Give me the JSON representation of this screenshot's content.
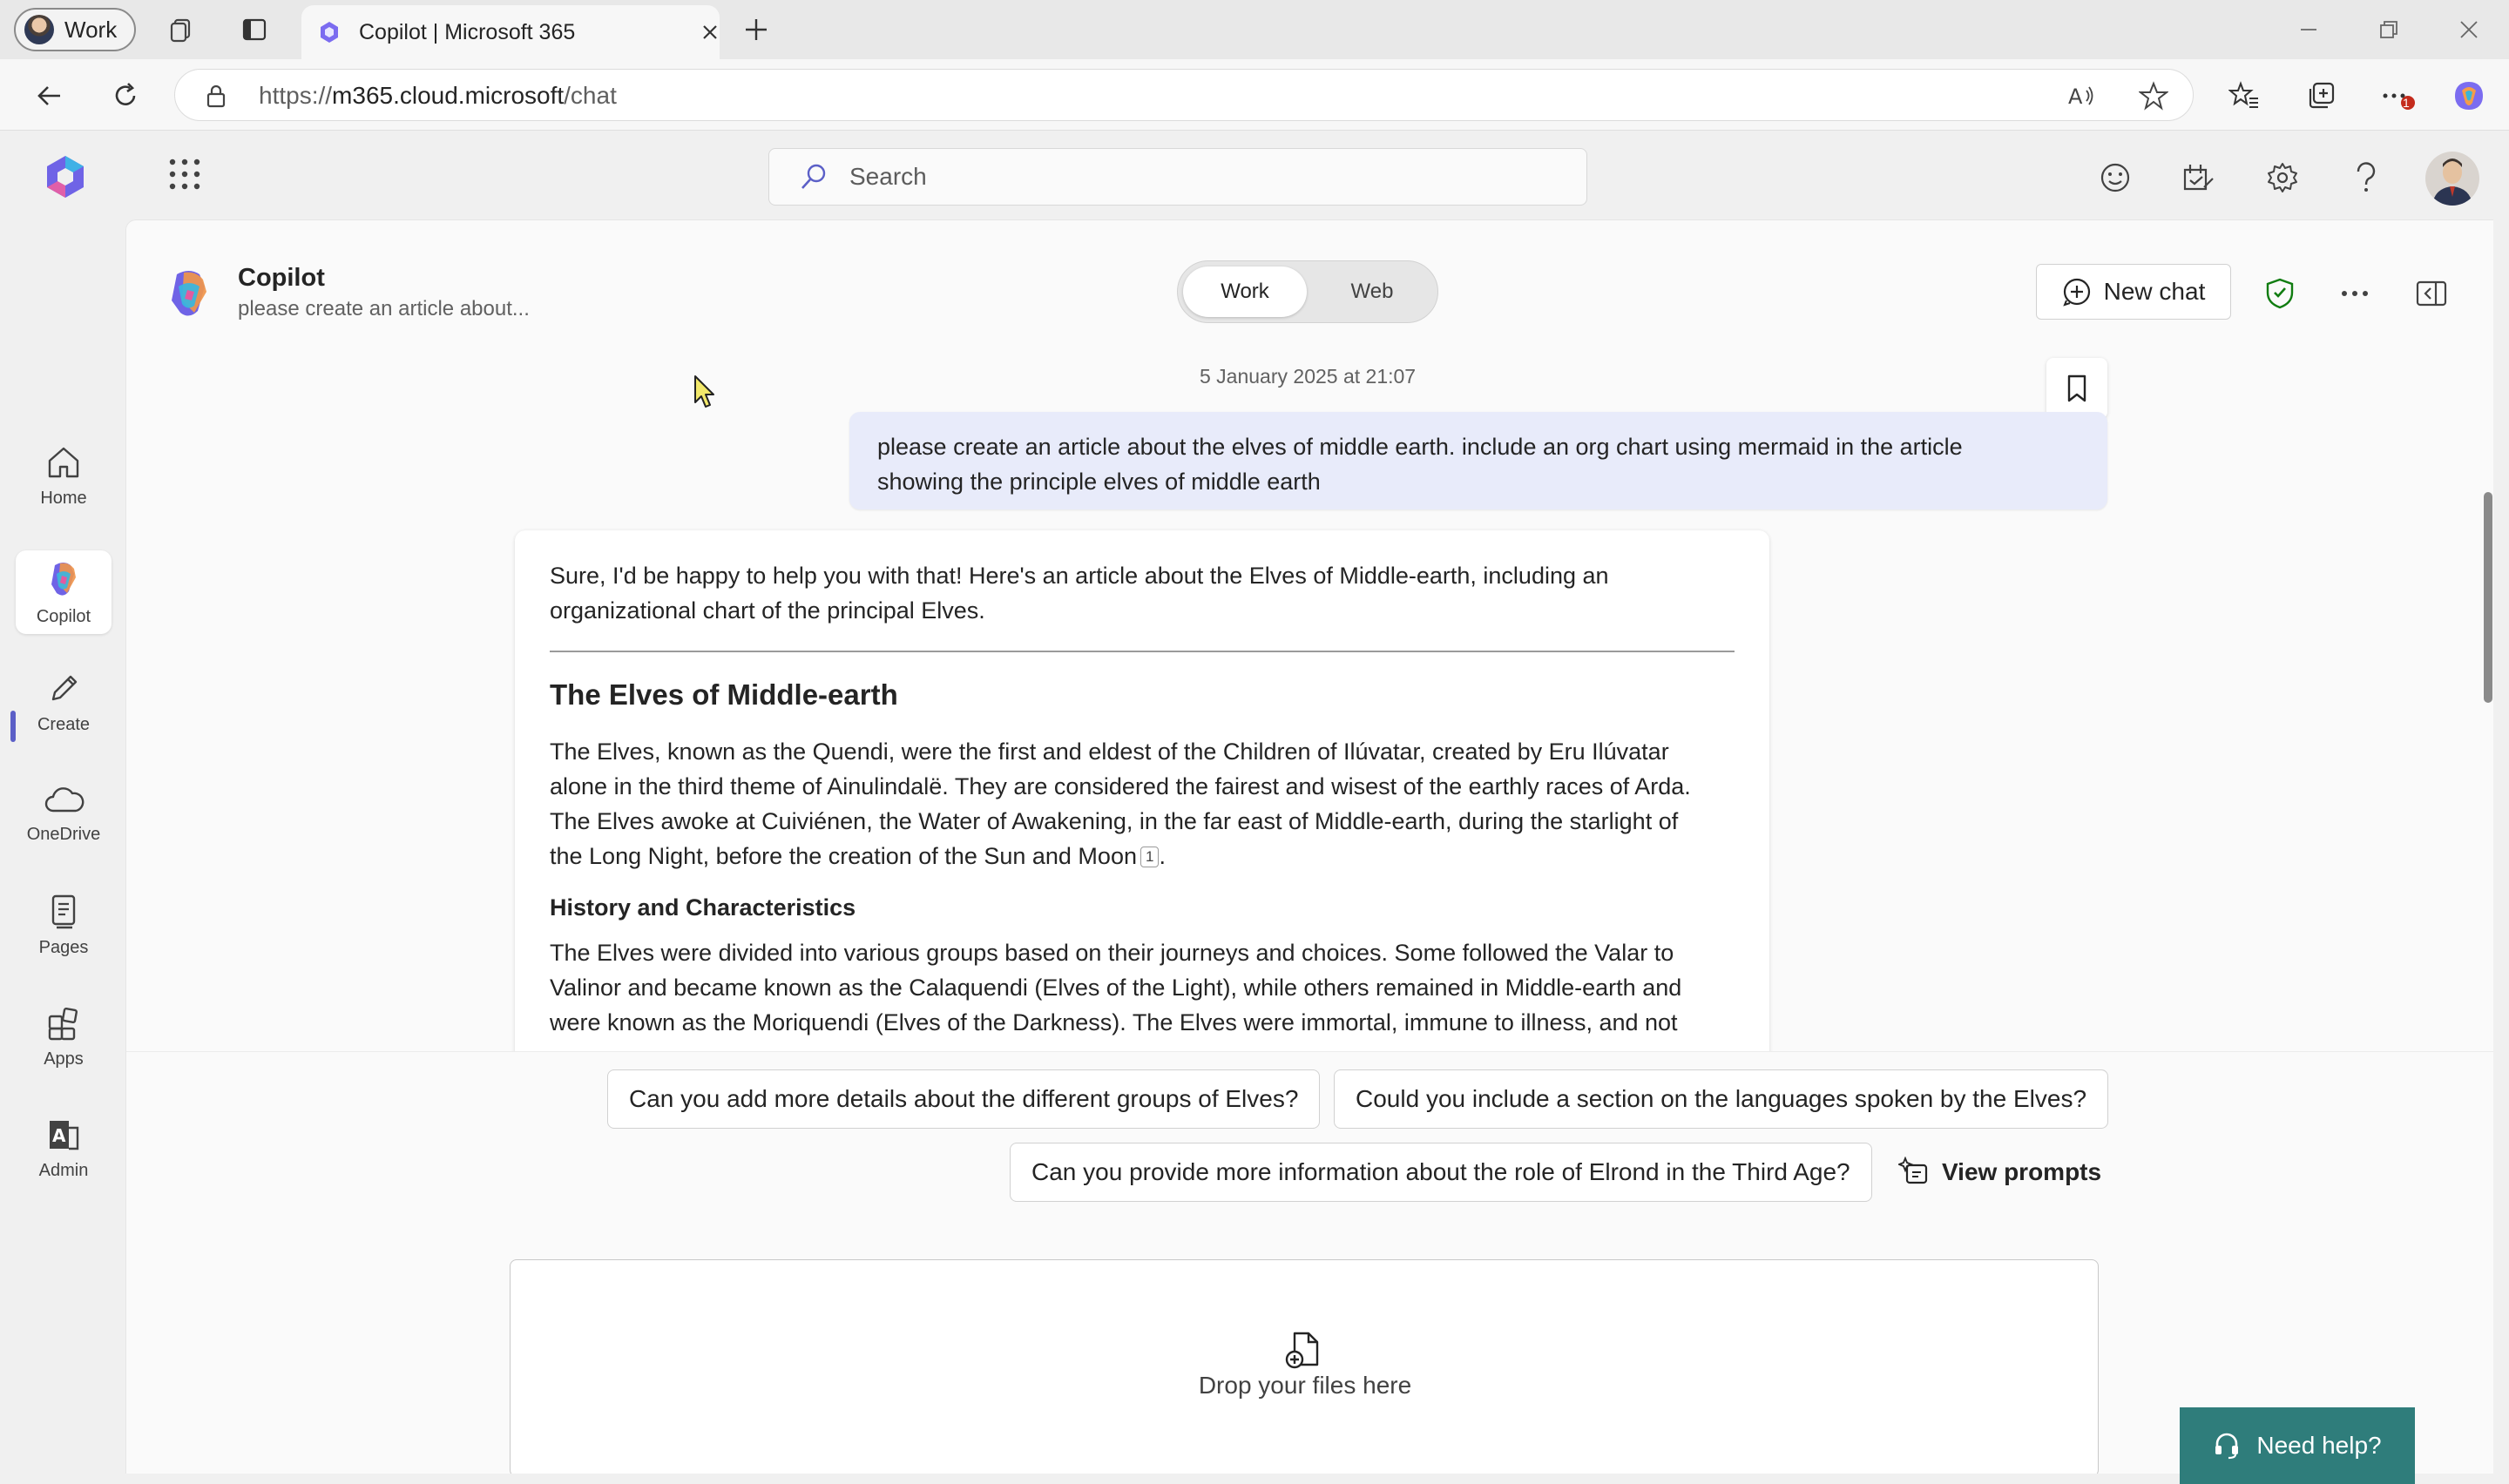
{
  "browser": {
    "profile_label": "Work",
    "tab_title": "Copilot | Microsoft 365",
    "url_prefix": "https://",
    "url_host": "m365.cloud.microsoft",
    "url_path": "/chat",
    "extension_badge": "1"
  },
  "m365": {
    "search_placeholder": "Search"
  },
  "rail": {
    "items": [
      {
        "label": "Home",
        "icon": "home-icon"
      },
      {
        "label": "Copilot",
        "icon": "copilot-icon"
      },
      {
        "label": "Create",
        "icon": "pencil-icon"
      },
      {
        "label": "OneDrive",
        "icon": "cloud-icon"
      },
      {
        "label": "Pages",
        "icon": "pages-icon"
      },
      {
        "label": "Apps",
        "icon": "apps-icon"
      },
      {
        "label": "Admin",
        "icon": "admin-icon"
      }
    ]
  },
  "chat": {
    "title": "Copilot",
    "subtitle": "please create an article about...",
    "toggle": {
      "work": "Work",
      "web": "Web",
      "selected": "Work"
    },
    "new_chat_label": "New chat",
    "timestamp": "5 January 2025 at 21:07",
    "user_message_line1": "please create an article about the elves of middle earth. include an org chart using mermaid in the article",
    "user_message_line2": "showing the principle elves of middle earth",
    "answer": {
      "intro_line1": "Sure, I'd be happy to help you with that! Here's an article about the Elves of Middle-earth, including an",
      "intro_line2": "organizational chart of the principal Elves.",
      "heading": "The Elves of Middle-earth",
      "para1_line1": "The Elves, known as the Quendi, were the first and eldest of the Children of Ilúvatar, created by Eru Ilúvatar",
      "para1_line2": "alone in the third theme of Ainulindalë. They are considered the fairest and wisest of the earthly races of Arda.",
      "para1_line3": "The Elves awoke at Cuiviénen, the Water of Awakening, in the far east of Middle-earth, during the starlight of",
      "para1_line4": "the Long Night, before the creation of the Sun and Moon",
      "citation": "1",
      "para1_end": ".",
      "subheading": "History and Characteristics",
      "para2_line1": "The Elves were divided into various groups based on their journeys and choices. Some followed the Valar to",
      "para2_line2": "Valinor and became known as the Calaquendi (Elves of the Light), while others remained in Middle-earth and",
      "para2_line3": "were known as the Moriquendi (Elves of the Darkness). The Elves were immortal, immune to illness, and not"
    },
    "suggestions": [
      "Can you add more details about the different groups of Elves?",
      "Could you include a section on the languages spoken by the Elves?",
      "Can you provide more information about the role of Elrond in the Third Age?"
    ],
    "view_prompts_label": "View prompts",
    "drop_label": "Drop your files here",
    "need_help_label": "Need help?"
  },
  "colors": {
    "accent": "#5b5fc7",
    "user_bubble": "#e8ebfa",
    "help_button": "#2f7d7b",
    "shield": "#107c10"
  }
}
